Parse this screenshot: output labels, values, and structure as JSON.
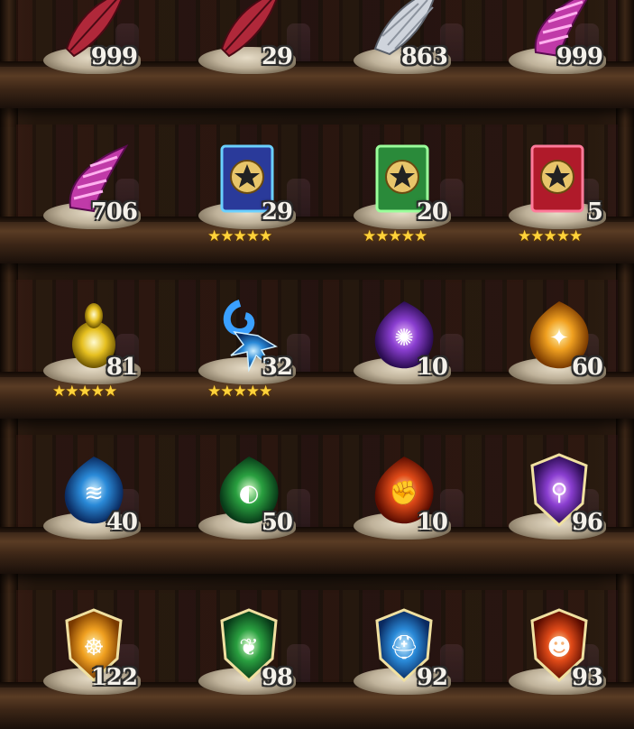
{
  "inventory": {
    "rows": [
      {
        "items": [
          {
            "name": "red-feather",
            "count": "999",
            "stars": 0
          },
          {
            "name": "red-feather",
            "count": "29",
            "stars": 0
          },
          {
            "name": "silver-wing",
            "count": "863",
            "stars": 0
          },
          {
            "name": "purple-horn",
            "count": "999",
            "stars": 0
          }
        ]
      },
      {
        "items": [
          {
            "name": "purple-horn",
            "count": "706",
            "stars": 0
          },
          {
            "name": "blue-star-tome",
            "count": "29",
            "stars": 5
          },
          {
            "name": "green-star-tome",
            "count": "20",
            "stars": 5
          },
          {
            "name": "red-star-tome",
            "count": "5",
            "stars": 5
          }
        ]
      },
      {
        "items": [
          {
            "name": "golden-idol",
            "count": "81",
            "stars": 5
          },
          {
            "name": "ice-crystal-staff",
            "count": "32",
            "stars": 5
          },
          {
            "name": "purple-flame-orb",
            "count": "10",
            "stars": 0
          },
          {
            "name": "orange-flame-orb",
            "count": "60",
            "stars": 0
          }
        ]
      },
      {
        "items": [
          {
            "name": "blue-flame-orb",
            "count": "40",
            "stars": 0
          },
          {
            "name": "green-flame-orb",
            "count": "50",
            "stars": 0
          },
          {
            "name": "red-flame-orb",
            "count": "10",
            "stars": 0
          },
          {
            "name": "purple-crest-shield",
            "count": "96",
            "stars": 0
          }
        ]
      },
      {
        "items": [
          {
            "name": "orange-crest-shield",
            "count": "122",
            "stars": 0
          },
          {
            "name": "green-crest-shield",
            "count": "98",
            "stars": 0
          },
          {
            "name": "blue-crest-shield",
            "count": "92",
            "stars": 0
          },
          {
            "name": "red-crest-shield",
            "count": "93",
            "stars": 0
          }
        ]
      }
    ],
    "star_glyph": "★★★★★"
  },
  "colors": {
    "star": "#ffd23a",
    "count_text": "#f4f1ea",
    "wood": "#3c2718"
  }
}
